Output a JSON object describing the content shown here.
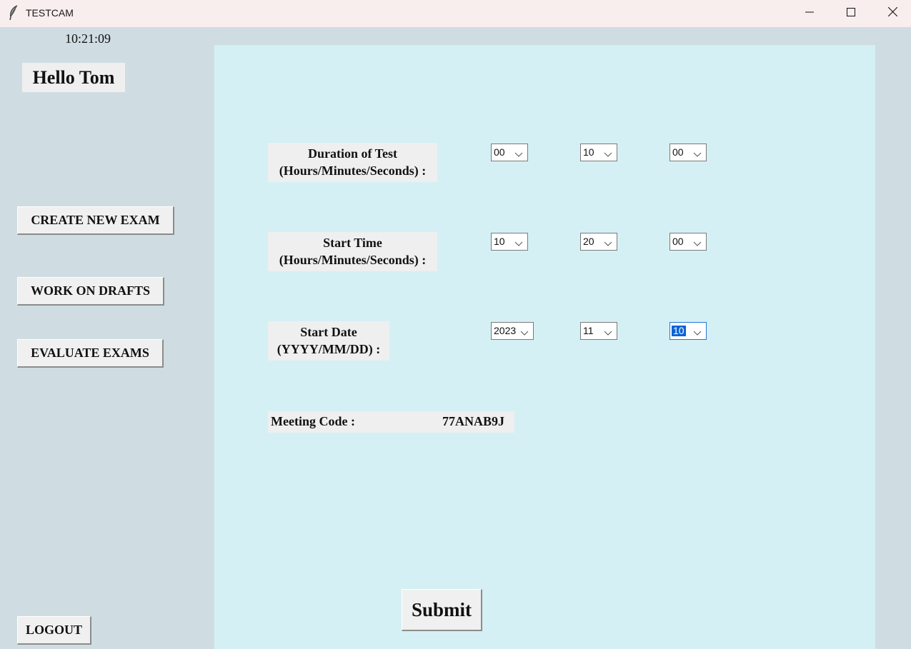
{
  "window": {
    "title": "TESTCAM",
    "icon": "feather-icon",
    "controls": [
      "minimize-icon",
      "maximize-icon",
      "close-icon"
    ]
  },
  "sidebar": {
    "clock": "10:21:09",
    "greeting": "Hello Tom",
    "buttons": {
      "create": "CREATE NEW EXAM",
      "drafts": "WORK ON DRAFTS",
      "evaluate": "EVALUATE EXAMS",
      "logout": "LOGOUT"
    }
  },
  "form": {
    "duration": {
      "label_line1": "Duration of Test",
      "label_line2": "(Hours/Minutes/Seconds) :",
      "hours": "00",
      "minutes": "10",
      "seconds": "00"
    },
    "start_time": {
      "label_line1": "Start Time",
      "label_line2": "(Hours/Minutes/Seconds) :",
      "hours": "10",
      "minutes": "20",
      "seconds": "00"
    },
    "start_date": {
      "label_line1": "Start Date",
      "label_line2": "(YYYY/MM/DD) :",
      "year": "2023",
      "month": "11",
      "day": "10"
    },
    "meeting": {
      "label": "Meeting Code :",
      "code": "77ANAB9J"
    },
    "submit_label": "Submit"
  },
  "colors": {
    "background": "#cfdde2",
    "panel": "#d4f0f4",
    "titlebar": "#f8eeed",
    "selection": "#0a64d4"
  }
}
